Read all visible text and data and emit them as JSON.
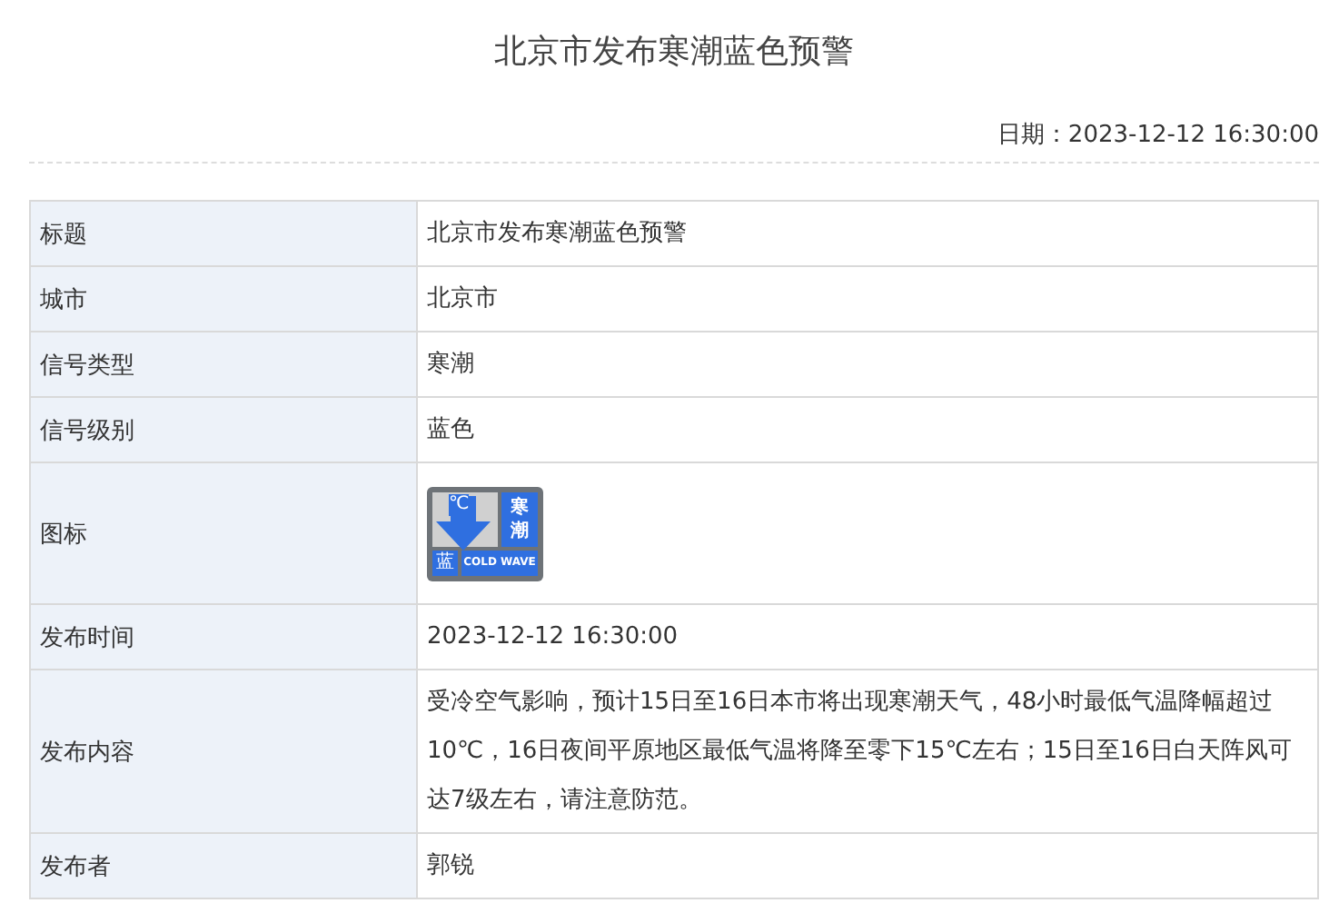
{
  "title": "北京市发布寒潮蓝色预警",
  "date": {
    "label": "日期：",
    "value": "2023-12-12 16:30:00"
  },
  "rows": [
    {
      "kind": "text",
      "label": "标题",
      "value": "北京市发布寒潮蓝色预警"
    },
    {
      "kind": "text",
      "label": "城市",
      "value": "北京市"
    },
    {
      "kind": "text",
      "label": "信号类型",
      "value": "寒潮"
    },
    {
      "kind": "text",
      "label": "信号级别",
      "value": "蓝色"
    },
    {
      "kind": "icon",
      "label": "图标",
      "icon": {
        "unit": "℃",
        "name": "寒潮",
        "level": "蓝",
        "english": "COLD WAVE",
        "color": "#2f6fe0"
      }
    },
    {
      "kind": "text",
      "label": "发布时间",
      "value": "2023-12-12 16:30:00"
    },
    {
      "kind": "text",
      "label": "发布内容",
      "value": "受冷空气影响，预计15日至16日本市将出现寒潮天气，48小时最低气温降幅超过10℃，16日夜间平原地区最低气温将降至零下15℃左右；15日至16日白天阵风可达7级左右，请注意防范。"
    },
    {
      "kind": "text",
      "label": "发布者",
      "value": "郭锐"
    }
  ]
}
